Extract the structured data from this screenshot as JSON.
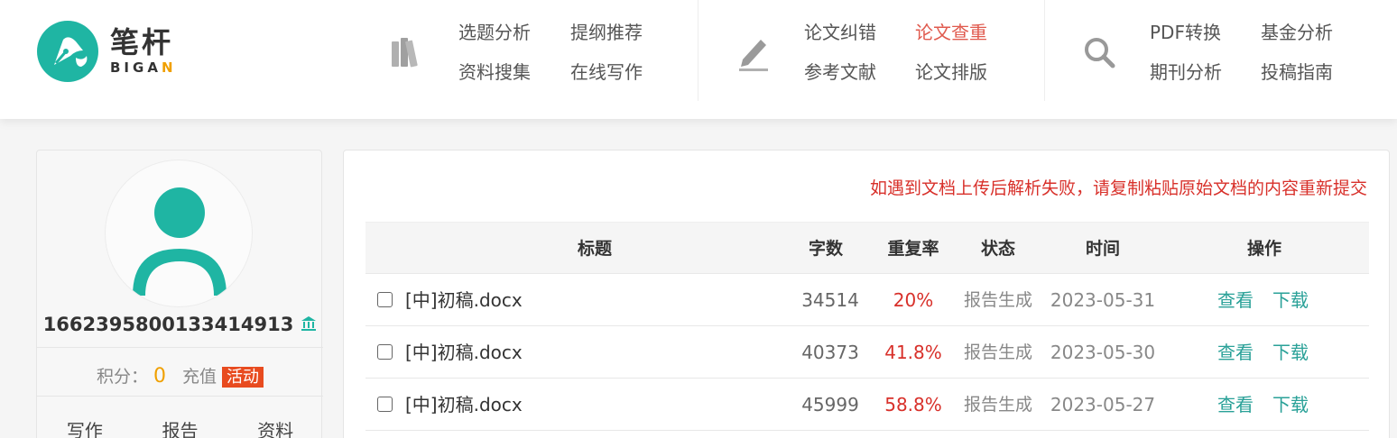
{
  "brand": {
    "name_cn": "笔杆",
    "name_en_main": "BIGA",
    "name_en_accent": "N",
    "teal_color": "#1fb5a3",
    "accent_color": "#f0a000"
  },
  "nav": {
    "group1": {
      "icon": "books-icon",
      "links": [
        "选题分析",
        "提纲推荐",
        "资料搜集",
        "在线写作"
      ]
    },
    "group2": {
      "icon": "pencil-icon",
      "links": [
        "论文纠错",
        "论文查重",
        "参考文献",
        "论文排版"
      ],
      "active": "论文查重"
    },
    "group3": {
      "icon": "search-icon",
      "links": [
        "PDF转换",
        "基金分析",
        "期刊分析",
        "投稿指南"
      ]
    }
  },
  "sidebar": {
    "username": "1662395800133414913",
    "points_label": "积分：",
    "points_value": "0",
    "recharge_label": "充值",
    "activity_label": "活动",
    "tabs": [
      "写作",
      "报告",
      "资料"
    ]
  },
  "main": {
    "notice": "如遇到文档上传后解析失败，请复制粘贴原始文档的内容重新提交",
    "notice_color": "#d8302a",
    "columns": {
      "title": "标题",
      "words": "字数",
      "rate": "重复率",
      "status": "状态",
      "time": "时间",
      "actions": "操作"
    },
    "rows": [
      {
        "title": "[中]初稿.docx",
        "words": "34514",
        "rate": "20%",
        "status": "报告生成",
        "time": "2023-05-31",
        "view": "查看",
        "download": "下载"
      },
      {
        "title": "[中]初稿.docx",
        "words": "40373",
        "rate": "41.8%",
        "status": "报告生成",
        "time": "2023-05-30",
        "view": "查看",
        "download": "下载"
      },
      {
        "title": "[中]初稿.docx",
        "words": "45999",
        "rate": "58.8%",
        "status": "报告生成",
        "time": "2023-05-27",
        "view": "查看",
        "download": "下载"
      }
    ]
  }
}
